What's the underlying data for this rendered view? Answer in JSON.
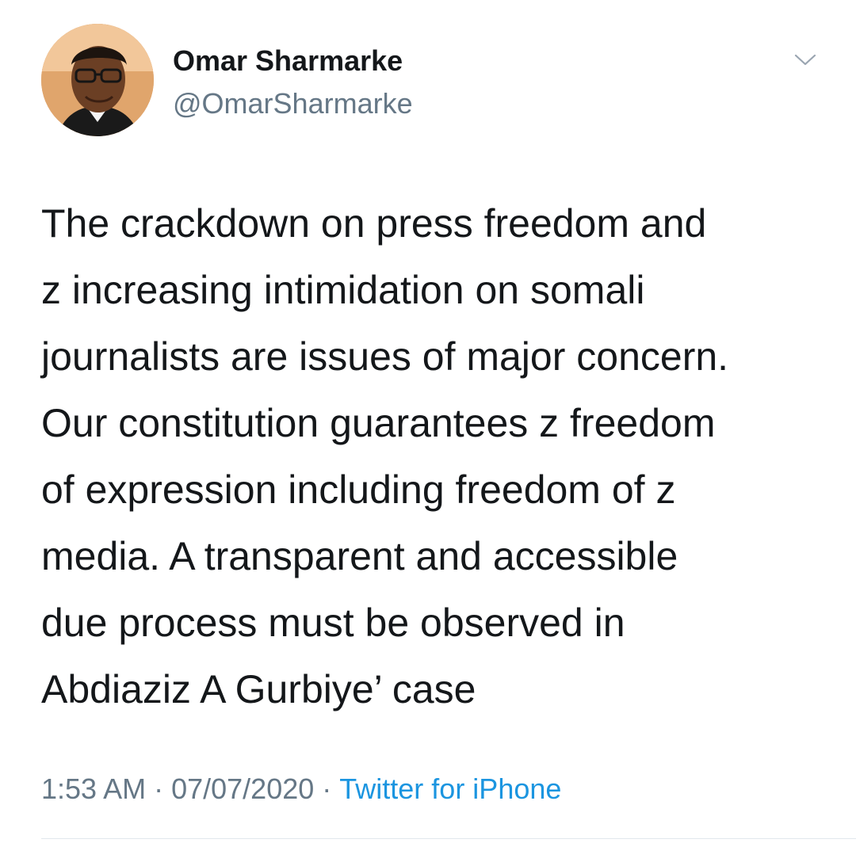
{
  "author": {
    "name": "Omar Sharmarke",
    "handle": "@OmarSharmarke",
    "avatar_icon": "profile-photo"
  },
  "tweet": {
    "text": "The crackdown on press freedom and\nz increasing intimidation on somali\njournalists are issues of major concern.\nOur constitution guarantees z freedom\nof expression including freedom of z\nmedia.  A transparent and accessible\ndue process must be observed in\nAbdiaziz A Gurbiye’ case"
  },
  "meta": {
    "time": "1:53 AM",
    "date": "07/07/2020",
    "separator": "·",
    "source": "Twitter for iPhone"
  },
  "colors": {
    "text": "#14171a",
    "secondary": "#657786",
    "link": "#1b95e0",
    "divider": "#e1e8ed"
  },
  "icons": {
    "more": "chevron-down-icon"
  }
}
